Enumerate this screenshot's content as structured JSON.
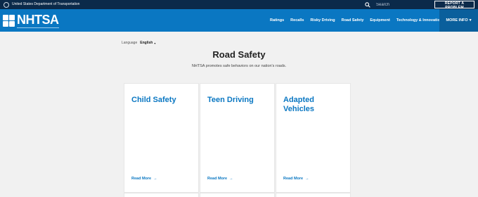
{
  "topbar": {
    "agency": "United States Department of Transportation",
    "search_placeholder": "Search",
    "report_button": "REPORT A PROBLEM"
  },
  "nav": {
    "logo_text": "NHTSA",
    "links": [
      "Ratings",
      "Recalls",
      "Risky Driving",
      "Road Safety",
      "Equipment",
      "Technology & Innovation"
    ],
    "more_info": "MORE INFO",
    "more_info_caret": "▾"
  },
  "language": {
    "label": "Language",
    "value": "English",
    "caret": "▾"
  },
  "page": {
    "title": "Road Safety",
    "description": "NHTSA promotes safe behaviors on our nation's roads."
  },
  "cards": [
    {
      "title": "Child Safety",
      "link": "Read More"
    },
    {
      "title": "Teen Driving",
      "link": "Read More"
    },
    {
      "title": "Adapted Vehicles",
      "link": "Read More"
    }
  ],
  "arrow_glyph": "→",
  "colors": {
    "topbar": "#0b2a4a",
    "nav": "#0a77c2",
    "nav_dark": "#0a5f9c",
    "link": "#0a77c2",
    "page_bg": "#f1f1f1"
  },
  "icons": {
    "search": "search-icon",
    "seal": "dot-seal-icon",
    "logo": "nhtsa-logo-icon"
  }
}
